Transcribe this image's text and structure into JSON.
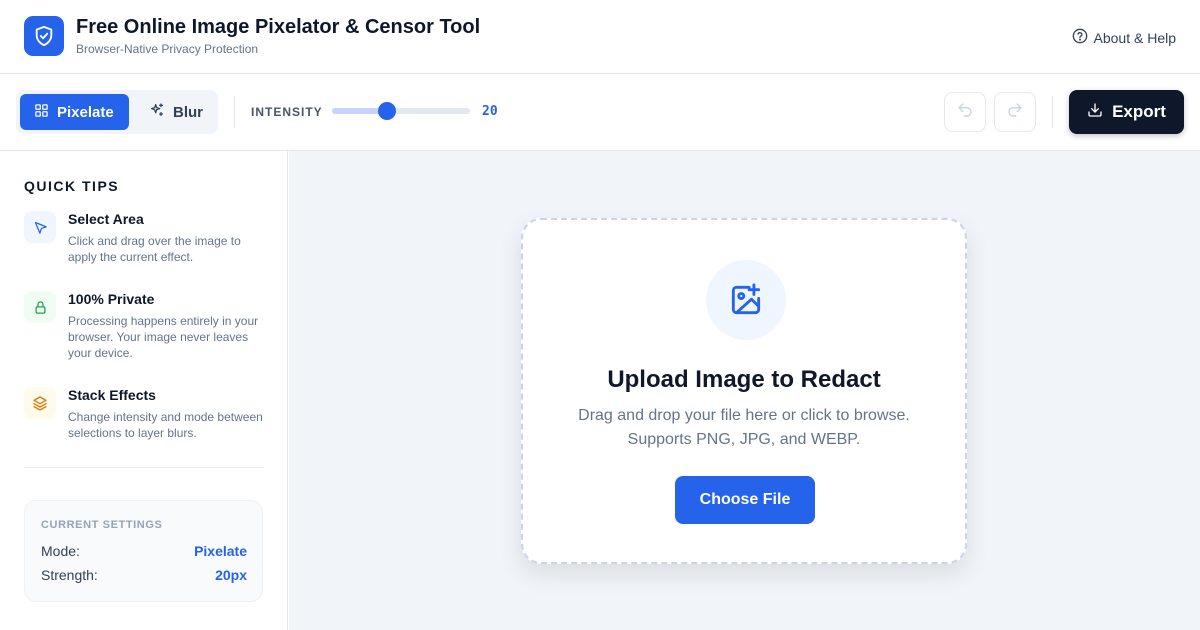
{
  "header": {
    "title": "Free Online Image Pixelator & Censor Tool",
    "subtitle": "Browser-Native Privacy Protection",
    "help_label": "About & Help"
  },
  "toolbar": {
    "modes": [
      {
        "label": "Pixelate",
        "icon": "grid-icon",
        "active": true
      },
      {
        "label": "Blur",
        "icon": "sparkles-icon",
        "active": false
      }
    ],
    "intensity_label": "INTENSITY",
    "intensity_value": "20",
    "intensity_fraction": 0.4,
    "undo_icon": "undo-icon",
    "redo_icon": "redo-icon",
    "export_label": "Export"
  },
  "sidebar": {
    "heading": "QUICK TIPS",
    "tips": [
      {
        "title": "Select Area",
        "body": "Click and drag over the image to apply the current effect.",
        "icon": "cursor-icon",
        "color": "#2563eb",
        "bg": "#eff6ff"
      },
      {
        "title": "100% Private",
        "body": "Processing happens entirely in your browser. Your image never leaves your device.",
        "icon": "lock-icon",
        "color": "#16a34a",
        "bg": "#f0fdf4"
      },
      {
        "title": "Stack Effects",
        "body": "Change intensity and mode between selections to layer blurs.",
        "icon": "layers-icon",
        "color": "#d97706",
        "bg": "#fffbeb"
      }
    ],
    "settings": {
      "heading": "CURRENT SETTINGS",
      "mode_label": "Mode:",
      "mode_value": "Pixelate",
      "strength_label": "Strength:",
      "strength_value": "20px"
    }
  },
  "main": {
    "upload_title": "Upload Image to Redact",
    "upload_desc_line1": "Drag and drop your file here or click to browse.",
    "upload_desc_line2": "Supports PNG, JPG, and WEBP.",
    "choose_label": "Choose File"
  },
  "colors": {
    "accent": "#2563eb",
    "dark": "#0f172a"
  }
}
